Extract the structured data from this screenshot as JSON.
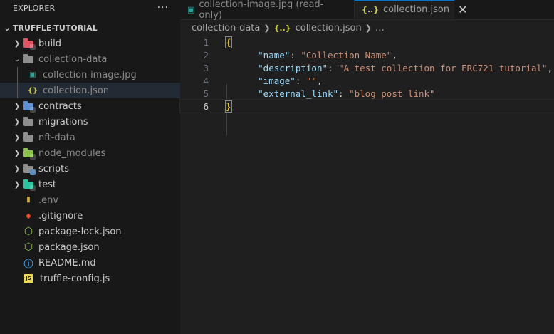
{
  "explorer": {
    "title": "EXPLORER",
    "more": "···",
    "root": "TRUFFLE-TUTORIAL",
    "items": [
      {
        "label": "build",
        "kind": "folder",
        "expanded": false,
        "depth": 0,
        "color": "#e05561",
        "icon": "build-folder-icon"
      },
      {
        "label": "collection-data",
        "kind": "folder",
        "expanded": true,
        "depth": 0,
        "color": "#8e8e8e",
        "icon": "folder-open-icon",
        "dim": true
      },
      {
        "label": "collection-image.jpg",
        "kind": "file",
        "depth": 1,
        "color": "#26a69a",
        "icon": "image-file-icon",
        "dim": true
      },
      {
        "label": "collection.json",
        "kind": "file",
        "depth": 1,
        "color": "#cbcb41",
        "icon": "json-file-icon",
        "dim": true,
        "active": true
      },
      {
        "label": "contracts",
        "kind": "folder",
        "expanded": false,
        "depth": 0,
        "color": "#5c8fd6",
        "icon": "contracts-folder-icon"
      },
      {
        "label": "migrations",
        "kind": "folder",
        "expanded": false,
        "depth": 0,
        "color": "#8e8e8e",
        "icon": "folder-icon"
      },
      {
        "label": "nft-data",
        "kind": "folder",
        "expanded": false,
        "depth": 0,
        "color": "#8e8e8e",
        "icon": "folder-icon",
        "dim": true
      },
      {
        "label": "node_modules",
        "kind": "folder",
        "expanded": false,
        "depth": 0,
        "color": "#8bc34a",
        "icon": "node-modules-folder-icon",
        "dim": true
      },
      {
        "label": "scripts",
        "kind": "folder",
        "expanded": false,
        "depth": 0,
        "color": "#8e8e8e",
        "icon": "scripts-folder-icon"
      },
      {
        "label": "test",
        "kind": "folder",
        "expanded": false,
        "depth": 0,
        "color": "#26c6a0",
        "icon": "test-folder-icon"
      },
      {
        "label": ".env",
        "kind": "file",
        "depth": 0,
        "color": "#f9c74f",
        "icon": "env-file-icon",
        "dim": true
      },
      {
        "label": ".gitignore",
        "kind": "file",
        "depth": 0,
        "color": "#f1502f",
        "icon": "git-file-icon"
      },
      {
        "label": "package-lock.json",
        "kind": "file",
        "depth": 0,
        "color": "#8bc34a",
        "icon": "node-file-icon"
      },
      {
        "label": "package.json",
        "kind": "file",
        "depth": 0,
        "color": "#8bc34a",
        "icon": "node-file-icon"
      },
      {
        "label": "README.md",
        "kind": "file",
        "depth": 0,
        "color": "#42a5f5",
        "icon": "info-file-icon"
      },
      {
        "label": "truffle-config.js",
        "kind": "file",
        "depth": 0,
        "color": "#f0db4f",
        "icon": "js-file-icon"
      }
    ]
  },
  "tabs": [
    {
      "label": "collection-image.jpg (read-only)",
      "active": false,
      "icon_glyph": "▣"
    },
    {
      "label": "collection.json",
      "active": true,
      "icon_glyph": "{..}",
      "close": "✕"
    }
  ],
  "breadcrumb": {
    "folder": "collection-data",
    "icon_glyph": "{..}",
    "file": "collection.json",
    "ellipsis": "…"
  },
  "code": {
    "line_numbers": [
      "1",
      "2",
      "3",
      "4",
      "5",
      "6"
    ],
    "current_line": 6,
    "open_brace": "{",
    "close_brace": "}",
    "entries": [
      {
        "key": "\"name\"",
        "value": "\"Collection Name\"",
        "comma": ","
      },
      {
        "key": "\"description\"",
        "value": "\"A test collection for ERC721 tutorial\"",
        "comma": ","
      },
      {
        "key": "\"image\"",
        "value": "\"\"",
        "comma": ","
      },
      {
        "key": "\"external_link\"",
        "value": "\"blog post link\"",
        "comma": ""
      }
    ]
  }
}
